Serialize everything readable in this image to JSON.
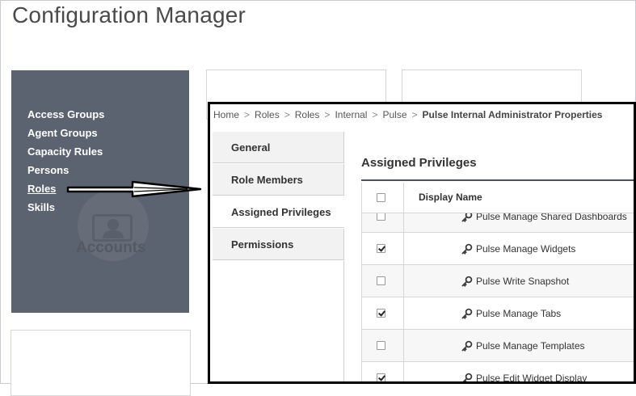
{
  "app": {
    "title": "Configuration Manager"
  },
  "accounts": {
    "label": "Accounts",
    "items": [
      {
        "label": "Access Groups",
        "active": false
      },
      {
        "label": "Agent Groups",
        "active": false
      },
      {
        "label": "Capacity Rules",
        "active": false
      },
      {
        "label": "Persons",
        "active": false
      },
      {
        "label": "Roles",
        "active": true
      },
      {
        "label": "Skills",
        "active": false
      }
    ]
  },
  "breadcrumb": {
    "items": [
      "Home",
      "Roles",
      "Roles",
      "Internal",
      "Pulse"
    ],
    "separator": ">",
    "current": "Pulse Internal Administrator Properties"
  },
  "tabs": [
    {
      "label": "General",
      "active": false
    },
    {
      "label": "Role Members",
      "active": false
    },
    {
      "label": "Assigned Privileges",
      "active": true
    },
    {
      "label": "Permissions",
      "active": false
    }
  ],
  "privileges": {
    "title": "Assigned Privileges",
    "column_header": "Display Name",
    "rows": [
      {
        "name": "Pulse Manage Shared Dashboards",
        "checked": false
      },
      {
        "name": "Pulse Manage Widgets",
        "checked": true
      },
      {
        "name": "Pulse Write Snapshot",
        "checked": false
      },
      {
        "name": "Pulse Manage Tabs",
        "checked": true
      },
      {
        "name": "Pulse Manage Templates",
        "checked": false
      },
      {
        "name": "Pulse Edit Widget Display",
        "checked": true
      }
    ]
  },
  "colors": {
    "card_bg": "#5c6370",
    "section_rule": "#4b525c",
    "window_border": "#000000"
  }
}
